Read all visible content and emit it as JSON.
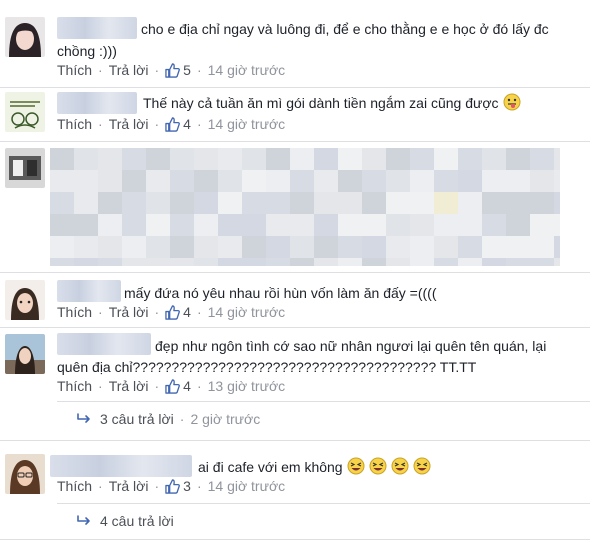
{
  "actions": {
    "like_label": "Thích",
    "reply_label": "Trả lời",
    "separator": "·"
  },
  "comments": [
    {
      "text_line1": "cho e địa chỉ ngay và luông đi, để e cho thằng e e học ở đó lấy đc",
      "text_line2": "chồng :)))",
      "likes": "5",
      "time": "14 giờ trước"
    },
    {
      "text_line1": "Thế này cả tuần ăn mì gói dành tiền ngắm zai cũng được",
      "likes": "4",
      "time": "14 giờ trước"
    },
    {
      "text_line1": "mấy đứa nó yêu nhau rồi hùn vốn làm ăn đấy =((((",
      "likes": "4",
      "time": "14 giờ trước"
    },
    {
      "text_line1": "đẹp như ngôn tình cớ sao nữ nhân ngươi lại quên tên quán, lại",
      "text_line2": "quên địa chỉ??????????????????????????????????????? TT.TT",
      "likes": "4",
      "time": "13 giờ trước",
      "replies": "3 câu trả lời",
      "replies_time": "2 giờ trước"
    },
    {
      "text_line1": "ai đi cafe với em không",
      "likes": "3",
      "time": "14 giờ trước",
      "replies": "4 câu trả lời"
    }
  ],
  "icons": {
    "like": "thumbs-up-icon",
    "reply_arrow": "reply-arrow-icon",
    "tongue_emoji": "tongue-out-emoji-icon",
    "laugh_emoji": "laughing-emoji-icon"
  },
  "colors": {
    "link": "#4b4f56",
    "muted": "#90949c",
    "like_blue": "#4267b2",
    "divider": "#dddfe2"
  }
}
